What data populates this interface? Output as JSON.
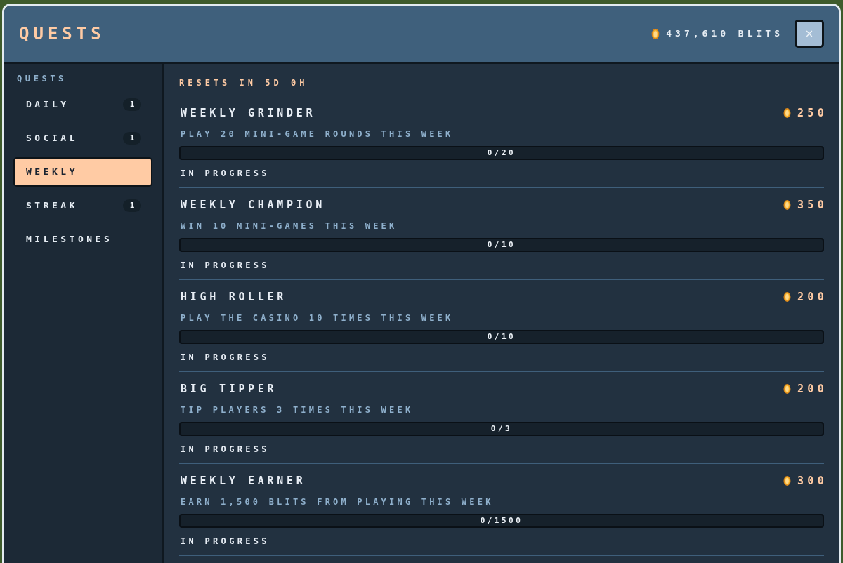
{
  "window": {
    "title": "QUESTS",
    "balance": "437,610 BLITS",
    "close": "×"
  },
  "sidebar": {
    "heading": "QUESTS",
    "items": [
      {
        "label": "DAILY",
        "badge": "1",
        "selected": false
      },
      {
        "label": "SOCIAL",
        "badge": "1",
        "selected": false
      },
      {
        "label": "WEEKLY",
        "selected": true
      },
      {
        "label": "STREAK",
        "badge": "1",
        "selected": false
      },
      {
        "label": "MILESTONES",
        "selected": false
      }
    ]
  },
  "main": {
    "reset_notice": "RESETS IN 5D 0H",
    "quests": [
      {
        "title": "WEEKLY GRINDER",
        "reward": "250",
        "description": "PLAY 20 MINI-GAME ROUNDS THIS WEEK",
        "progress": "0/20",
        "level": 0,
        "status": "IN PROGRESS"
      },
      {
        "title": "WEEKLY CHAMPION",
        "reward": "350",
        "description": "WIN 10 MINI-GAMES THIS WEEK",
        "progress": "0/10",
        "level": 0,
        "status": "IN PROGRESS"
      },
      {
        "title": "HIGH ROLLER",
        "reward": "200",
        "description": "PLAY THE CASINO 10 TIMES THIS WEEK",
        "progress": "0/10",
        "level": 0,
        "status": "IN PROGRESS"
      },
      {
        "title": "BIG TIPPER",
        "reward": "200",
        "description": "TIP PLAYERS 3 TIMES THIS WEEK",
        "progress": "0/3",
        "level": 0,
        "status": "IN PROGRESS"
      },
      {
        "title": "WEEKLY EARNER",
        "reward": "300",
        "description": "EARN 1,500 BLITS FROM PLAYING THIS WEEK",
        "progress": "0/1500",
        "level": 0,
        "status": "IN PROGRESS"
      }
    ]
  }
}
